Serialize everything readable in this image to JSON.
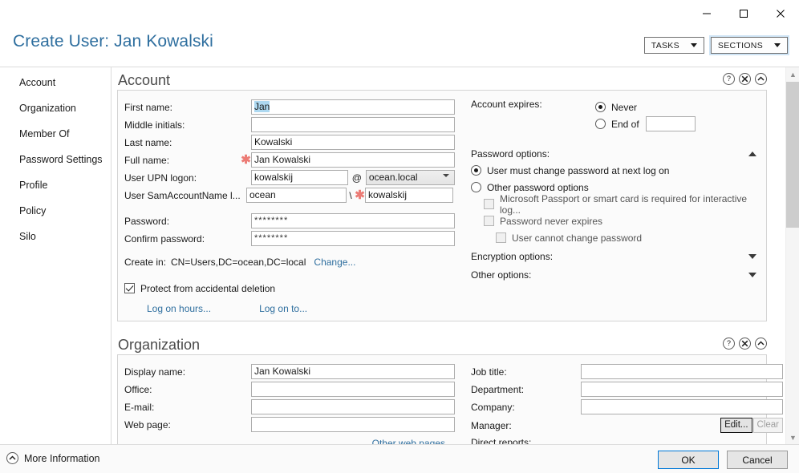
{
  "window": {
    "controls": [
      {
        "name": "minimize",
        "glyph": "minimize-icon"
      },
      {
        "name": "maximize",
        "glyph": "maximize-icon"
      },
      {
        "name": "close",
        "glyph": "close-icon"
      }
    ]
  },
  "header": {
    "title": "Create User: Jan Kowalski",
    "tasks_label": "TASKS",
    "sections_label": "SECTIONS"
  },
  "nav": {
    "items": [
      {
        "label": "Account"
      },
      {
        "label": "Organization"
      },
      {
        "label": "Member Of"
      },
      {
        "label": "Password Settings"
      },
      {
        "label": "Profile"
      },
      {
        "label": "Policy"
      },
      {
        "label": "Silo"
      }
    ]
  },
  "account": {
    "section_title": "Account",
    "help_icon": "help-icon",
    "close_icon": "close-circle-icon",
    "collapse_icon": "collapse-circle-icon",
    "fields": {
      "first_name_label": "First name:",
      "first_name_value": "Jan",
      "middle_initials_label": "Middle initials:",
      "middle_initials_value": "",
      "last_name_label": "Last name:",
      "last_name_value": "Kowalski",
      "full_name_label": "Full name:",
      "full_name_value": "Jan Kowalski",
      "upn_label": "User UPN logon:",
      "upn_value": "kowalskij",
      "upn_at": "@",
      "upn_domain": "ocean.local",
      "sam_label": "User SamAccountName l...",
      "sam_domain": "ocean",
      "sam_slash": "\\",
      "sam_value": "kowalskij",
      "password_label": "Password:",
      "password_value": "********",
      "confirm_label": "Confirm password:",
      "confirm_value": "********",
      "create_in_label": "Create in:",
      "create_in_value": "CN=Users,DC=ocean,DC=local",
      "create_in_change": "Change...",
      "protect_label": "Protect from accidental deletion",
      "protect_checked": true,
      "logon_hours": "Log on hours...",
      "logon_to": "Log on to..."
    },
    "right": {
      "account_expires_label": "Account expires:",
      "never_label": "Never",
      "never_selected": true,
      "end_of_label": "End of",
      "end_of_value": "",
      "password_options_label": "Password options:",
      "password_options_expanded": true,
      "must_change_label": "User must change password at next log on",
      "must_change_selected": true,
      "other_options_label": "Other password options",
      "other_options_selected": false,
      "passport_label": "Microsoft Passport or smart card is required for interactive log...",
      "passport_checked": false,
      "never_expires_label": "Password never expires",
      "never_expires_checked": false,
      "cannot_change_label": "User cannot change password",
      "cannot_change_checked": false,
      "encryption_options_label": "Encryption options:",
      "other_opts_label": "Other options:"
    }
  },
  "organization": {
    "section_title": "Organization",
    "help_icon": "help-icon",
    "close_icon": "close-circle-icon",
    "collapse_icon": "collapse-circle-icon",
    "fields": {
      "display_name_label": "Display name:",
      "display_name_value": "Jan Kowalski",
      "office_label": "Office:",
      "office_value": "",
      "email_label": "E-mail:",
      "email_value": "",
      "web_page_label": "Web page:",
      "web_page_value": "",
      "other_web_pages": "Other web pages..."
    },
    "right": {
      "job_title_label": "Job title:",
      "job_title_value": "",
      "department_label": "Department:",
      "department_value": "",
      "company_label": "Company:",
      "company_value": "",
      "manager_label": "Manager:",
      "manager_edit": "Edit...",
      "manager_clear": "Clear",
      "direct_reports_label": "Direct reports:"
    }
  },
  "footer": {
    "more_information": "More Information",
    "ok_label": "OK",
    "cancel_label": "Cancel"
  },
  "colors": {
    "accent": "#2f6f9f",
    "asterisk": "#ec7b75",
    "selection": "#add8f0",
    "focus": "#0078d7"
  }
}
